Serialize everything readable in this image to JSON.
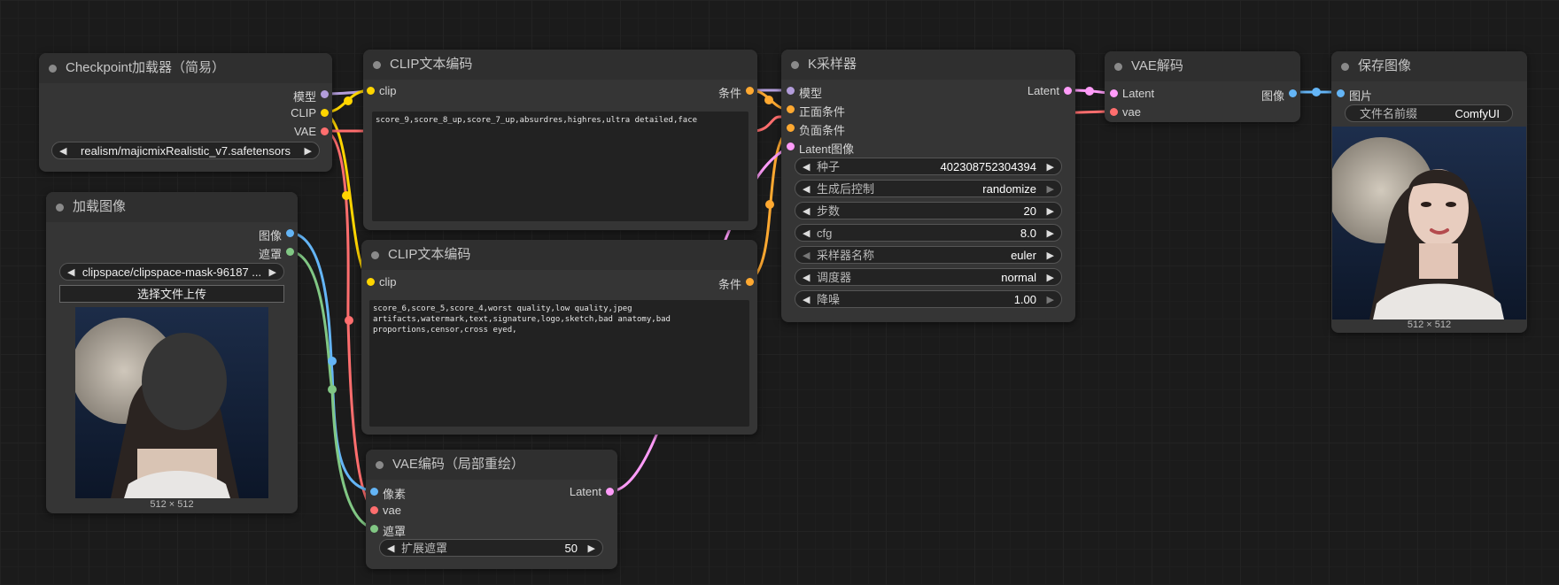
{
  "nodes": {
    "checkpoint": {
      "title": "Checkpoint加载器（简易）",
      "outputs": [
        "模型",
        "CLIP",
        "VAE"
      ],
      "ckpt_name": "realism/majicmixRealistic_v7.safetensors"
    },
    "load_image": {
      "title": "加载图像",
      "outputs": [
        "图像",
        "遮罩"
      ],
      "image": "clipspace/clipspace-mask-96187 ...",
      "upload_label": "选择文件上传",
      "size_caption": "512 × 512"
    },
    "clip_pos": {
      "title": "CLIP文本编码",
      "input": "clip",
      "output": "条件",
      "text": "score_9,score_8_up,score_7_up,absurdres,highres,ultra detailed,face"
    },
    "clip_neg": {
      "title": "CLIP文本编码",
      "input": "clip",
      "output": "条件",
      "text": "score_6,score_5,score_4,worst quality,low quality,jpeg\nartifacts,watermark,text,signature,logo,sketch,bad anatomy,bad\nproportions,censor,cross eyed,"
    },
    "vae_encode": {
      "title": "VAE编码（局部重绘）",
      "inputs": [
        "像素",
        "vae",
        "遮罩"
      ],
      "output": "Latent",
      "grow_label": "扩展遮罩",
      "grow_value": "50"
    },
    "ksampler": {
      "title": "K采样器",
      "inputs": [
        "模型",
        "正面条件",
        "负面条件",
        "Latent图像"
      ],
      "output": "Latent",
      "widgets": [
        {
          "label": "种子",
          "value": "402308752304394"
        },
        {
          "label": "生成后控制",
          "value": "randomize"
        },
        {
          "label": "步数",
          "value": "20"
        },
        {
          "label": "cfg",
          "value": "8.0"
        },
        {
          "label": "采样器名称",
          "value": "euler"
        },
        {
          "label": "调度器",
          "value": "normal"
        },
        {
          "label": "降噪",
          "value": "1.00"
        }
      ]
    },
    "vae_decode": {
      "title": "VAE解码",
      "inputs": [
        "Latent",
        "vae"
      ],
      "output": "图像"
    },
    "save_image": {
      "title": "保存图像",
      "input": "图片",
      "prefix_label": "文件名前缀",
      "prefix_value": "ComfyUI",
      "size_caption": "512 × 512"
    }
  },
  "colors": {
    "model": "#b39ddb",
    "clip": "#ffd500",
    "vae": "#ff6e6e",
    "image": "#64b5f6",
    "mask": "#81c784",
    "latent": "#ff9cf9",
    "conditioning": "#ffa931"
  }
}
